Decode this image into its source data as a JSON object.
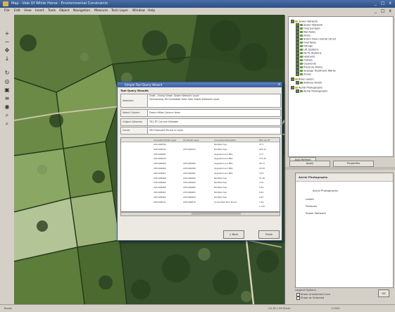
{
  "window": {
    "title": "Map - Vale Of White Horse - Environmental Constraints",
    "controls": "_ □ x"
  },
  "menubar": {
    "items": [
      "File",
      "Edit",
      "View",
      "Insert",
      "Tools",
      "Object",
      "Navigation",
      "Measure",
      "Tech Layer",
      "Window",
      "Help"
    ],
    "controls": "_ □ x"
  },
  "left_toolbar": {
    "tools": [
      {
        "icon": "zoom-in-icon",
        "glyph": "+"
      },
      {
        "icon": "zoom-out-icon",
        "glyph": "−"
      },
      {
        "icon": "pan-icon",
        "glyph": "✥"
      },
      {
        "icon": "arrow-icon",
        "glyph": "↓"
      },
      {
        "icon": "refresh-icon",
        "glyph": "↻"
      },
      {
        "icon": "info-icon",
        "glyph": "◎"
      },
      {
        "icon": "select-icon",
        "glyph": "▣"
      },
      {
        "icon": "measure-icon",
        "glyph": "≡"
      },
      {
        "icon": "binoculars-icon",
        "glyph": "◉"
      },
      {
        "icon": "search-icon",
        "glyph": "⌕"
      },
      {
        "icon": "magnifier-icon",
        "glyph": "⌕"
      }
    ]
  },
  "layer_tree": {
    "items": [
      {
        "label": "Sewer Network",
        "level": 0,
        "type": "folder"
      },
      {
        "label": "Sewer Network",
        "level": 1,
        "type": "layer"
      },
      {
        "label": "Overpumped",
        "level": 1,
        "type": "layer"
      },
      {
        "label": "Manholes",
        "level": 1,
        "type": "layer"
      },
      {
        "label": "Inlets",
        "level": 1,
        "type": "layer"
      },
      {
        "label": "Storm Flow Control Struct",
        "level": 1,
        "type": "layer"
      },
      {
        "label": "Overflows",
        "level": 1,
        "type": "layer"
      },
      {
        "label": "Fittings",
        "level": 1,
        "type": "layer"
      },
      {
        "label": "Lift Stations",
        "level": 1,
        "type": "layer"
      },
      {
        "label": "NCTS Stations",
        "level": 1,
        "type": "layer"
      },
      {
        "label": "Hydrants",
        "level": 1,
        "type": "layer"
      },
      {
        "label": "Outlets",
        "level": 1,
        "type": "layer"
      },
      {
        "label": "Cleanouts",
        "level": 1,
        "type": "layer"
      },
      {
        "label": "Pressure Mains",
        "level": 1,
        "type": "layer"
      },
      {
        "label": "Sewage Treatment Works",
        "level": 1,
        "type": "layer"
      },
      {
        "label": "Zones",
        "level": 1,
        "type": "layer"
      },
      {
        "label": "Base Layers",
        "level": 0,
        "type": "folder"
      },
      {
        "label": "Address Points",
        "level": 1,
        "type": "layer"
      },
      {
        "label": "Aerial Photographs",
        "level": 0,
        "type": "folder"
      },
      {
        "label": "Aerial Photographs",
        "level": 1,
        "type": "layer"
      }
    ]
  },
  "tree_controls": {
    "auto_refresh_label": "Auto Refresh",
    "apply_label": "Apply",
    "properties_label": "Properties"
  },
  "layer_properties": {
    "title": "Aerial Photographs",
    "rows": [
      "Aerial Photographs",
      "Labels",
      "Features",
      "Sewer Network"
    ]
  },
  "options": {
    "legend_label": "Legend Options",
    "opt1": "Show Unselected Line",
    "opt2": "Show as Selected",
    "ok_label": "OK"
  },
  "statusbar": {
    "left": "Ready",
    "coords": "-24.18  1.56  Sheet",
    "scale": "1:2500"
  },
  "dialog": {
    "title": "Simple Tool Query Wizard",
    "close_glyph": "x",
    "section_title": "Tool Query Results",
    "fields": [
      {
        "label": "Selection",
        "value": "Draft - Ewing Sewer Sewer Network Layer\nIntersecting 3D Candidate Area from Sewer Network Layer"
      },
      {
        "label": "Select Column",
        "value": "Drain=Miles Column Area"
      },
      {
        "label": "Output Columns",
        "value": "TID, RT Column Editable"
      },
      {
        "label": "Count",
        "value": "990 Featured Found in Layer"
      }
    ],
    "table": {
      "columns": [
        "",
        "Converted Model Layer",
        "Old Model Layer",
        "Converted Description",
        "Pipe Len M"
      ],
      "rows": [
        [
          "",
          "2031496350",
          "",
          "Modified Sup",
          "27.3"
        ],
        [
          "",
          "2031496431",
          "2031496354",
          "Modified Sup",
          "265.13"
        ],
        [
          "",
          "2031496461",
          "",
          "Upgraded and PRG",
          "13.7"
        ],
        [
          "",
          "2031496433",
          "",
          "Upgraded and PRG",
          "173.43"
        ],
        [
          "",
          "2031496464",
          "2031496360",
          "Upgraded and PRG",
          "28.77"
        ],
        [
          "",
          "2031496466",
          "2031496366",
          "Upgraded and PRG",
          "43.93"
        ],
        [
          "",
          "2031496467",
          "2031496461",
          "Upgraded and PRG",
          "3.43"
        ],
        [
          "",
          "2031496468",
          "2031496466",
          "Modified Sup",
          "71.36"
        ],
        [
          "",
          "2031496469",
          "2031496462",
          "Modified Sup",
          "3.01"
        ],
        [
          "",
          "2031496460",
          "2031496465",
          "Modified Sup",
          "2.05"
        ],
        [
          "",
          "2031496461",
          "2031496463",
          "Modified Sup",
          "6.40"
        ],
        [
          "",
          "2031496462",
          "2031496464",
          "Modified Sup",
          "3.87"
        ],
        [
          "",
          "2031496471",
          "2031496470",
          "Unmodified Mod Struct",
          "1.46"
        ],
        [
          "",
          "",
          "",
          "",
          "1.730"
        ]
      ]
    },
    "back_label": "< Back",
    "finish_label": "Finish"
  }
}
